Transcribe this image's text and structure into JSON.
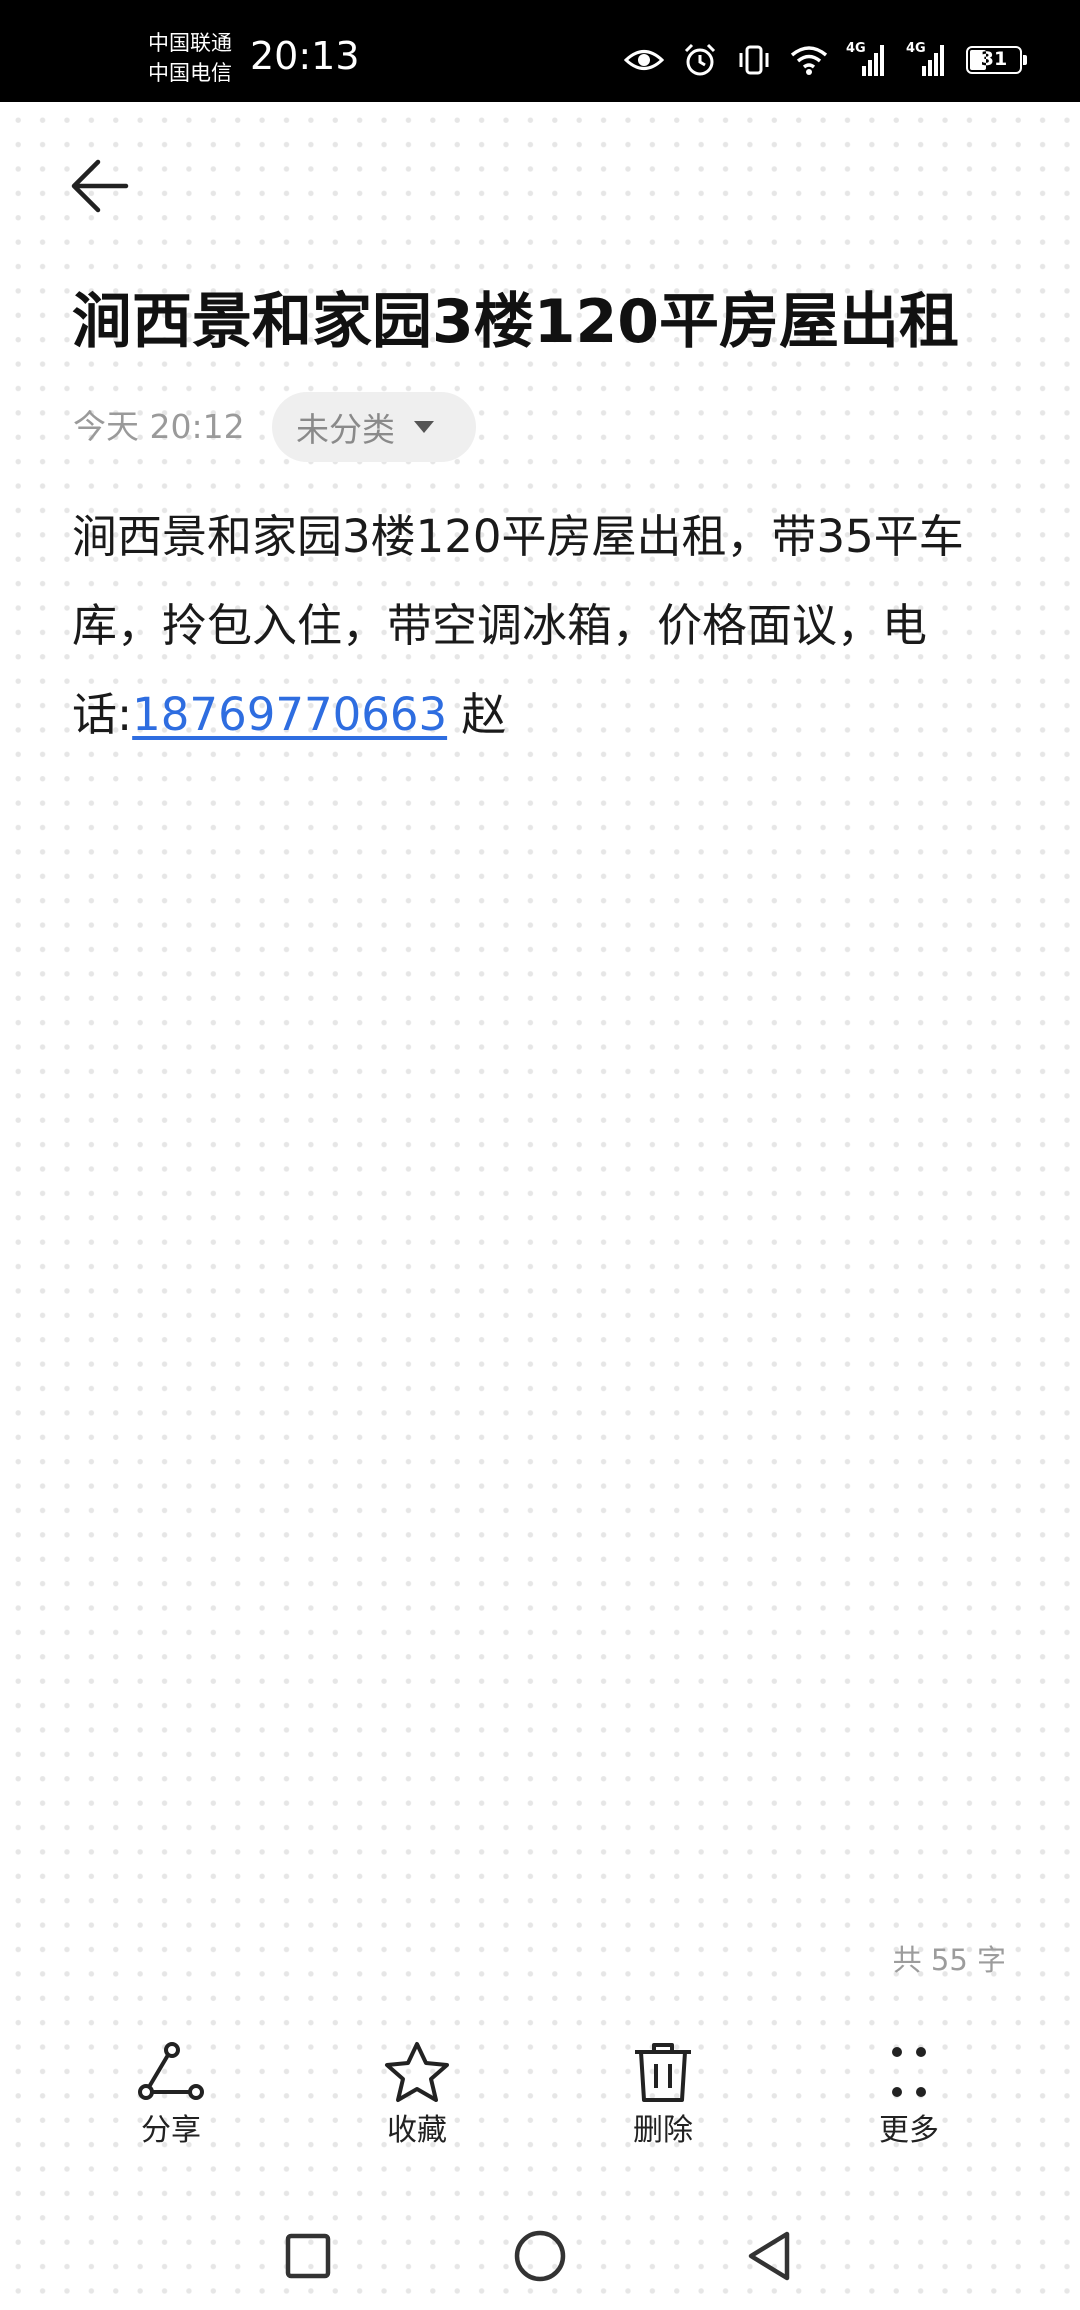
{
  "status_bar": {
    "carrier_1": "中国联通",
    "carrier_2": "中国电信",
    "time": "20:13",
    "signal_label_1": "4G",
    "signal_label_2": "4G",
    "battery_level": "31"
  },
  "note": {
    "title": "涧西景和家园3楼120平房屋出租",
    "date": "今天 20:12",
    "category": "未分类",
    "body_text": "涧西景和家园3楼120平房屋出租，带35平车库，拎包入住，带空调冰箱，价格面议，电话:",
    "phone": "18769770663",
    "body_suffix": " 赵",
    "word_count": "共 55 字"
  },
  "toolbar": {
    "share": "分享",
    "favorite": "收藏",
    "delete": "删除",
    "more": "更多"
  },
  "icons": {
    "back": "arrow-left-icon",
    "share": "share-icon",
    "favorite": "star-icon",
    "delete": "trash-icon",
    "more": "four-dots-icon",
    "recents": "square-icon",
    "home": "circle-icon",
    "nav_back": "triangle-left-icon"
  },
  "colors": {
    "link": "#2e6de0",
    "muted_text": "#9a9a9a",
    "chip_background": "#efefef"
  }
}
